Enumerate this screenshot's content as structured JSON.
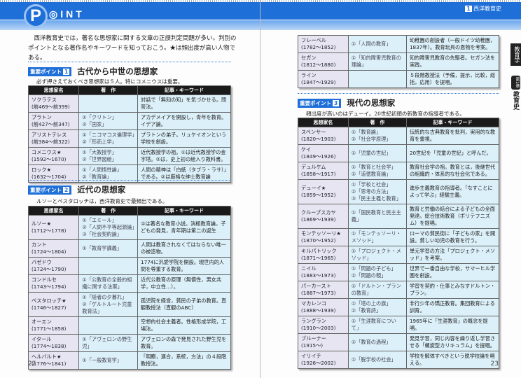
{
  "header": {
    "logo_letter": "P",
    "logo_word": "◎INT",
    "chapter_num": "1",
    "chapter": "西洋教育史"
  },
  "intro": "西洋教育史では，著名な思想家に関する文章の正誤判定問題が多い。判別のポイントとなる著作名やキーワードを知っておこう。★は頻出度が高い人物である。",
  "columns": [
    "思想家名",
    "著　作",
    "記事・キーワード"
  ],
  "sections": [
    {
      "badge": "重要ポイント",
      "num": "1",
      "title": "古代から中世の思想家",
      "sub": "必ず押さえておくべき思想家は５人。特にコメニウスは重要。",
      "rows": [
        {
          "name": "ソクラテス",
          "years": "(前469～前399)",
          "works": [],
          "kw": "対話で「無知の知」を気づかせる。問答法。"
        },
        {
          "name": "プラトン",
          "years": "(前427～前347)",
          "works": [
            "①「クリトン」",
            "②「国家」"
          ],
          "kw": "アカデメイアを開設し，青年を教育。イデア論。"
        },
        {
          "name": "アリストテレス",
          "years": "(前384～前322)",
          "works": [
            "①「ニコマコス倫理学」",
            "②「形而上学」"
          ],
          "kw": "プラトンの弟子。リュケイオンという学校を創設。"
        },
        {
          "name": "コメニウス★",
          "years": "(1592～1670)",
          "works": [
            "①「大教授学」",
            "②「世界図絵」"
          ],
          "kw": "近代教授学の祖。①は近代教授学の金字塔。②は，史上初の絵入り教科書。"
        },
        {
          "name": "ロック★",
          "years": "(1632～1704)",
          "works": [
            "①「人間悟性論」",
            "②「教育論」"
          ],
          "kw": "人間の精神は「白紙（タブラ・ラサ）」である。②は厳格な紳士教育論"
        }
      ]
    },
    {
      "badge": "重要ポイント",
      "num": "2",
      "title": "近代の思想家",
      "sub": "ルソーとペスタロッチは，西洋教育史で最頻出である。",
      "rows": [
        {
          "name": "ルソー★",
          "years": "(1712～1778)",
          "works": [
            "①「エミール」",
            "②「人間不平等起源論」",
            "③「社会契約論」"
          ],
          "kw": "①は著名な教育小説。消極教育論，子どもの発見，青年期は第二の誕生"
        },
        {
          "name": "カント",
          "years": "(1724～1804)",
          "works": [
            "①「教育学講義」"
          ],
          "kw": "人間は教育されなくてはならない唯一の被造物。"
        },
        {
          "name": "バゼドウ",
          "years": "(1724～1790)",
          "works": [],
          "kw": "1774に汎愛学院を開設。現世内的人間を尊重する教育。"
        },
        {
          "name": "コンドルセ",
          "years": "(1743～1794)",
          "works": [
            "①「公教育の全般的組織に関する法案」"
          ],
          "kw": "近代公教育の原理（無償性，男女共学，中立性…）。"
        },
        {
          "name": "ペスタロッチ★",
          "years": "(1746～1827)",
          "works": [
            "①「隠者の夕暮れ」",
            "②「ゲルトルート児童教育法」"
          ],
          "kw": "孤児院を経営，貧民の子弟の教育。直観教授法（直観のABC）"
        },
        {
          "name": "オーエン",
          "years": "(1771～1858)",
          "works": [],
          "kw": "空想的社会主義者。性格形成学院，工場法。"
        },
        {
          "name": "イタール",
          "years": "(1774～1838)",
          "works": [
            "①「アヴェロンの野生児」"
          ],
          "kw": "アヴェロンの森で発見された野生児を教育。"
        },
        {
          "name": "ヘルバルト★",
          "years": "(1776～1841)",
          "works": [
            "①「一般教育学」"
          ],
          "kw": "「明瞭，連合，系統，方法」の４段階教授法。"
        }
      ]
    },
    {
      "rows": [
        {
          "name": "フレーベル",
          "years": "(1782～1852)",
          "works": [
            "①「人間の教育」"
          ],
          "kw": "幼稚園の創設者（一般ドイツ幼稚園，1837年）。教育玩具の恩物を考案。"
        },
        {
          "name": "セガン",
          "years": "(1812～1880)",
          "works": [
            "①「知的障害児教育の理論」"
          ],
          "kw": "知的障害児教育の先駆者。セガン法を実践。"
        },
        {
          "name": "ライン",
          "years": "(1847～1929)",
          "works": [],
          "kw": "５段階教授法（予備，提示，比較，総括，応用）を提唱。"
        }
      ]
    },
    {
      "badge": "重要ポイント",
      "num": "3",
      "title": "現代の思想家",
      "sub": "頻出度が高いのはデューイ。20世紀初頭の新教育の指導者である。",
      "rows": [
        {
          "name": "スペンサー",
          "years": "(1820～1903)",
          "works": [
            "①「教育論」",
            "②「社会学原理」"
          ],
          "kw": "伝統的な古典教育を批判，実用的な教育を重視。"
        },
        {
          "name": "ケイ",
          "years": "(1849～1926)",
          "works": [
            "①「児童の世紀」"
          ],
          "kw": "20世紀を「児童の世紀」と呼んだ。"
        },
        {
          "name": "デュルケム",
          "years": "(1858～1917)",
          "works": [
            "①「教育と社会学」",
            "②「道徳教育論」"
          ],
          "kw": "教育社会学の祖。教育とは，後継世代の組織的・体系的な社会化である。"
        },
        {
          "name": "デューイ★",
          "years": "(1859～1952)",
          "works": [
            "①「学校と社会」",
            "②「思考の方法」",
            "③「民主主義と教育」"
          ],
          "kw": "進歩主義教育の指導者。「なすことによって学ぶ」経験主義。"
        },
        {
          "name": "クループスカヤ",
          "years": "(1869～1939)",
          "works": [
            "①「国民教育と民主主義」"
          ],
          "kw": "教育と労働の結合による子どもの全面発達。総合技術教育（ポリテフニズム）を提唱。"
        },
        {
          "name": "モンテッソーリ★",
          "years": "(1870～1952)",
          "works": [
            "①「モンテッソーリ・メソッド」"
          ],
          "kw": "ローマの貧民街に「子どもの家」を開設。貧しい幼児の教育を行う。"
        },
        {
          "name": "キルパトリック",
          "years": "(1871～1965)",
          "works": [
            "①「プロジェクト・メソッド」"
          ],
          "kw": "単元学習の方法「プロジェクト・メソッド」を考案。"
        },
        {
          "name": "ニイル",
          "years": "(1883～1973)",
          "works": [
            "①「問題の子ども」",
            "②「問題の親」"
          ],
          "kw": "世界で一番自由な学校，サマーヒル学園を創設。"
        },
        {
          "name": "パーカースト",
          "years": "(1887～1973)",
          "works": [
            "①「ドルトン・プランの教育」"
          ],
          "kw": "学習を契約・仕事とみなすドルトン・プラン。"
        },
        {
          "name": "マカレンコ",
          "years": "(1888～1939)",
          "works": [
            "①「塔の上の旗」",
            "②「教育詩」"
          ],
          "kw": "非行少年の矯正教育。集団教育による訓育。"
        },
        {
          "name": "ラングラン",
          "years": "(1910～2003)",
          "works": [
            "①「生涯教育について」"
          ],
          "kw": "1965年に「生涯教育」の概念を提唱。"
        },
        {
          "name": "ブルーナー",
          "years": "(1915～)",
          "works": [
            "①「教育の過程」"
          ],
          "kw": "発見学習，同じ内容を繰り返し学習させる「螺旋型カリキュラム」を提唱。"
        },
        {
          "name": "イリイチ",
          "years": "(1926～2002)",
          "works": [
            "①「脱学校の社会」"
          ],
          "kw": "学校を解体すべきという脱学校論を唱える。"
        }
      ]
    }
  ],
  "pages": {
    "left": "22",
    "right": "23"
  },
  "side": {
    "subject": "教育学",
    "chapter": "第1章",
    "topic": "教育史"
  }
}
